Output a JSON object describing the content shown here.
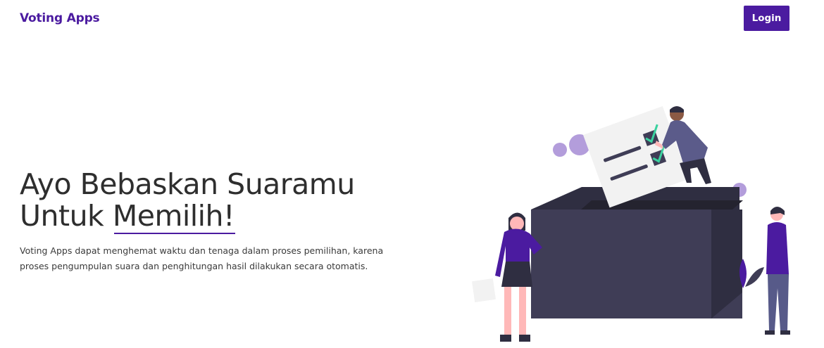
{
  "navbar": {
    "brand": "Voting Apps",
    "login_label": "Login"
  },
  "hero": {
    "headline_line1": "Ayo Bebaskan Suaramu",
    "headline_line2_prefix": "Untuk ",
    "headline_line2_highlight": "Memilih!",
    "subtitle": "Voting Apps dapat menghemat waktu dan tenaga dalam proses pemilihan, karena proses pengumpulan suara dan penghitungan hasil dilakukan secara otomatis."
  },
  "illustration": {
    "icon": "ballot-box-voting-illustration",
    "colors": {
      "accent": "#4b1ba0",
      "box_dark": "#3f3d56",
      "box_darker": "#2f2e41",
      "paper": "#f2f2f2",
      "check": "#3ad29f",
      "bubble": "#b39ddb",
      "skin": "#ffb8b8"
    }
  }
}
